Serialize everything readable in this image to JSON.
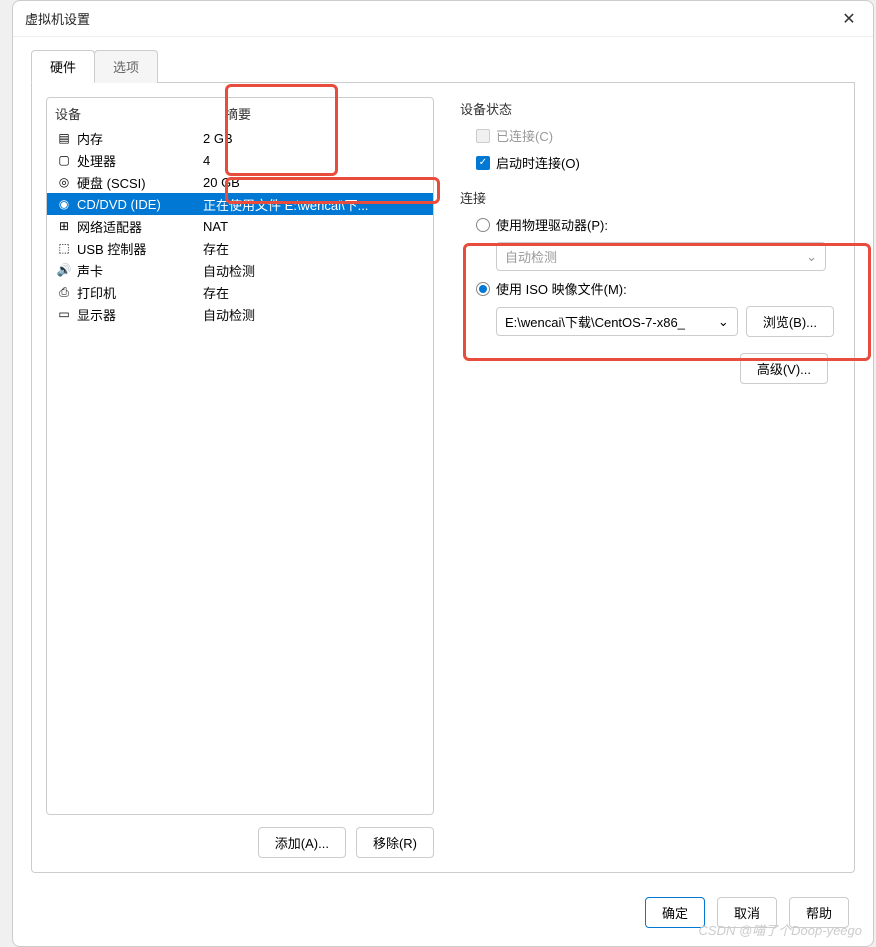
{
  "window": {
    "title": "虚拟机设置"
  },
  "tabs": {
    "hardware": "硬件",
    "options": "选项"
  },
  "deviceList": {
    "header": {
      "device": "设备",
      "summary": "摘要"
    },
    "items": [
      {
        "icon": "▤",
        "name": "内存",
        "summary": "2 GB"
      },
      {
        "icon": "▢",
        "name": "处理器",
        "summary": "4"
      },
      {
        "icon": "◎",
        "name": "硬盘 (SCSI)",
        "summary": "20 GB"
      },
      {
        "icon": "◉",
        "name": "CD/DVD (IDE)",
        "summary": "正在使用文件 E:\\wencai\\下..."
      },
      {
        "icon": "⊞",
        "name": "网络适配器",
        "summary": "NAT"
      },
      {
        "icon": "⬚",
        "name": "USB 控制器",
        "summary": "存在"
      },
      {
        "icon": "🔊",
        "name": "声卡",
        "summary": "自动检测"
      },
      {
        "icon": "⎙",
        "name": "打印机",
        "summary": "存在"
      },
      {
        "icon": "▭",
        "name": "显示器",
        "summary": "自动检测"
      }
    ],
    "actions": {
      "add": "添加(A)...",
      "remove": "移除(R)"
    }
  },
  "rightPane": {
    "deviceStatus": {
      "title": "设备状态",
      "connected": "已连接(C)",
      "connectAtPowerOn": "启动时连接(O)"
    },
    "connection": {
      "title": "连接",
      "usePhysical": "使用物理驱动器(P):",
      "physicalValue": "自动检测",
      "useISO": "使用 ISO 映像文件(M):",
      "isoPath": "E:\\wencai\\下载\\CentOS-7-x86_",
      "browse": "浏览(B)..."
    },
    "advanced": "高级(V)..."
  },
  "dialogButtons": {
    "ok": "确定",
    "cancel": "取消",
    "help": "帮助"
  },
  "watermark": "CSDN @喵了个Doop-yeego"
}
